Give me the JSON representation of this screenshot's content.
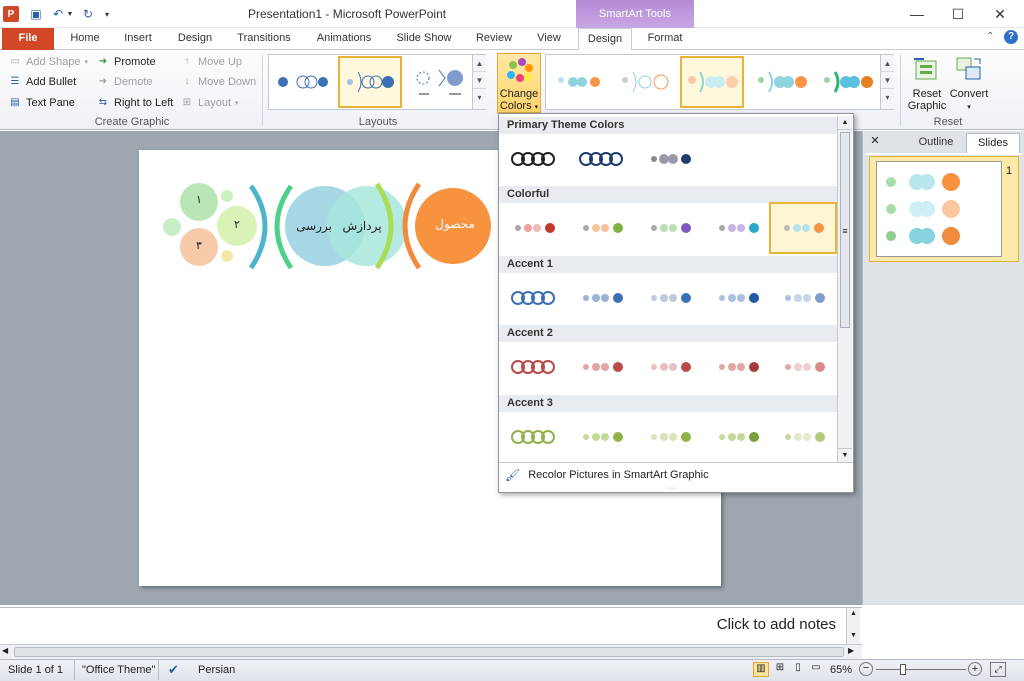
{
  "window": {
    "title": "Presentation1  -  Microsoft PowerPoint",
    "context_tab": "SmartArt Tools"
  },
  "tabs": [
    {
      "label": "File"
    },
    {
      "label": "Home"
    },
    {
      "label": "Insert"
    },
    {
      "label": "Design"
    },
    {
      "label": "Transitions"
    },
    {
      "label": "Animations"
    },
    {
      "label": "Slide Show"
    },
    {
      "label": "Review"
    },
    {
      "label": "View"
    },
    {
      "label": "Design"
    },
    {
      "label": "Format"
    }
  ],
  "ribbon": {
    "create_graphic": {
      "label": "Create Graphic",
      "add_shape": "Add Shape",
      "add_bullet": "Add Bullet",
      "text_pane": "Text Pane",
      "promote": "Promote",
      "demote": "Demote",
      "right_to_left": "Right to Left",
      "move_up": "Move Up",
      "move_down": "Move Down",
      "layout": "Layout"
    },
    "layouts": {
      "label": "Layouts"
    },
    "change_colors": {
      "line1": "Change",
      "line2": "Colors"
    },
    "reset": {
      "label": "Reset",
      "reset_graphic_1": "Reset",
      "reset_graphic_2": "Graphic",
      "convert": "Convert"
    }
  },
  "dropdown": {
    "sections": [
      "Primary Theme Colors",
      "Colorful",
      "Accent 1",
      "Accent 2",
      "Accent 3"
    ],
    "recolor": "Recolor Pictures in SmartArt Graphic"
  },
  "slide": {
    "circle1": "۱",
    "circle2": "۲",
    "circle3": "۳",
    "review": "بررسی",
    "process": "پردازش",
    "product": "محصول"
  },
  "panel": {
    "outline_tab": "Outline",
    "slides_tab": "Slides",
    "slide_number": "1"
  },
  "notes": {
    "placeholder": "Click to add notes"
  },
  "status": {
    "slide": "Slide 1 of 1",
    "theme": "\"Office Theme\"",
    "language": "Persian",
    "zoom": "65%"
  },
  "colors": {
    "accent": "#e8b53a",
    "file_tab": "#d24726",
    "context": "#b58ad6"
  }
}
